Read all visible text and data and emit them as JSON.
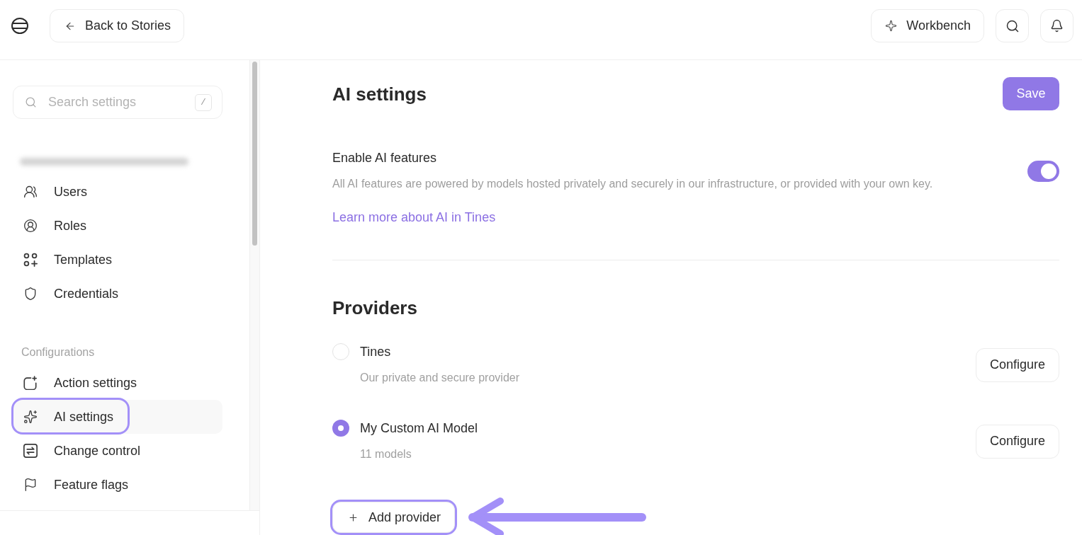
{
  "header": {
    "back_button": "Back to Stories",
    "workbench_button": "Workbench"
  },
  "sidebar": {
    "search": {
      "placeholder": "Search settings",
      "shortcut": "/"
    },
    "sections": [
      {
        "items": [
          {
            "label": "Users",
            "selected": false,
            "highlighted": false
          },
          {
            "label": "Roles",
            "selected": false,
            "highlighted": false
          },
          {
            "label": "Templates",
            "selected": false,
            "highlighted": false
          },
          {
            "label": "Credentials",
            "selected": false,
            "highlighted": false
          }
        ]
      },
      {
        "heading": "Configurations",
        "items": [
          {
            "label": "Action settings",
            "selected": false,
            "highlighted": false
          },
          {
            "label": "AI settings",
            "selected": true,
            "highlighted": true
          },
          {
            "label": "Change control",
            "selected": false,
            "highlighted": false
          },
          {
            "label": "Feature flags",
            "selected": false,
            "highlighted": false
          }
        ]
      }
    ]
  },
  "main": {
    "title": "AI settings",
    "save_button": "Save",
    "ai_features": {
      "label": "Enable AI features",
      "description": "All AI features are powered by models hosted privately and securely in our infrastructure, or provided with your own key.",
      "on": true,
      "link": "Learn more about AI in Tines"
    },
    "providers": {
      "heading": "Providers",
      "items": [
        {
          "name": "Tines",
          "description": "Our private and secure provider",
          "selected": false,
          "button": "Configure"
        },
        {
          "name": "My Custom AI Model",
          "description": "11 models",
          "selected": true,
          "button": "Configure"
        }
      ],
      "add_button": {
        "label": "Add provider",
        "highlighted": true,
        "arrow": true
      }
    }
  }
}
